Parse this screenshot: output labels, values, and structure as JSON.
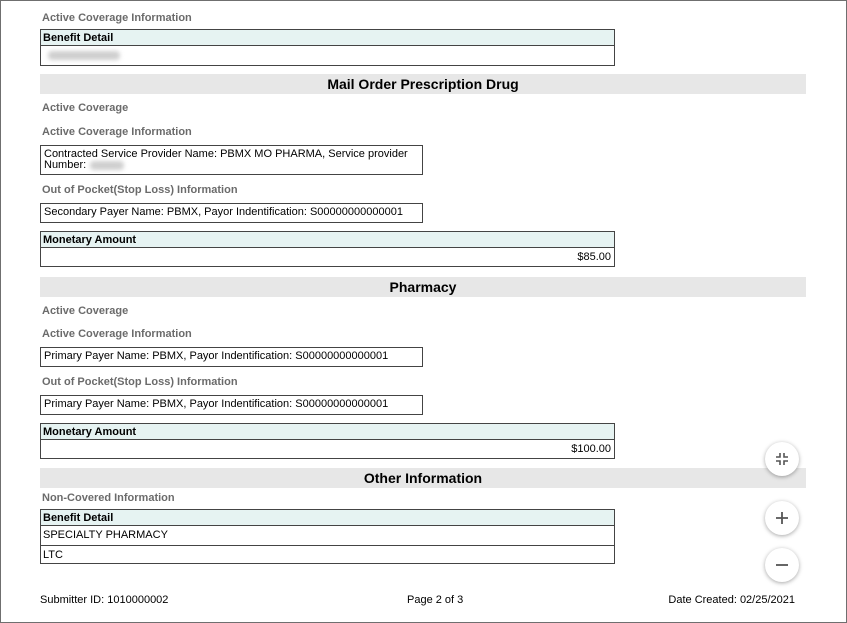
{
  "top": {
    "section_label": "Active Coverage Information",
    "table_header": "Benefit Detail"
  },
  "mail_order": {
    "title": "Mail Order Prescription Drug",
    "active_coverage": "Active Coverage",
    "active_coverage_info": "Active Coverage Information",
    "provider_line1": "Contracted Service Provider Name: PBMX MO PHARMA, Service provider",
    "provider_line2": "Number:",
    "oop_label": "Out of Pocket(Stop Loss) Information",
    "oop_text": "Secondary Payer Name: PBMX, Payor Indentification: S00000000000001",
    "monetary_header": "Monetary Amount",
    "monetary_value": "$85.00"
  },
  "pharmacy": {
    "title": "Pharmacy",
    "active_coverage": "Active Coverage",
    "active_coverage_info": "Active Coverage Information",
    "payer_text": "Primary Payer Name: PBMX, Payor Indentification: S00000000000001",
    "oop_label": "Out of Pocket(Stop Loss) Information",
    "oop_text": "Primary Payer Name: PBMX, Payor Indentification: S00000000000001",
    "monetary_header": "Monetary Amount",
    "monetary_value": "$100.00"
  },
  "other": {
    "title": "Other Information",
    "non_covered": "Non-Covered Information",
    "table_header": "Benefit Detail",
    "rows": [
      "SPECIALTY PHARMACY",
      "LTC"
    ]
  },
  "footer": {
    "submitter": "Submitter ID: 1010000002",
    "page": "Page 2 of 3",
    "date": "Date Created: 02/25/2021"
  },
  "controls": {
    "collapse_icon": "collapse-icon",
    "zoom_in_icon": "plus-icon",
    "zoom_out_icon": "minus-icon"
  }
}
